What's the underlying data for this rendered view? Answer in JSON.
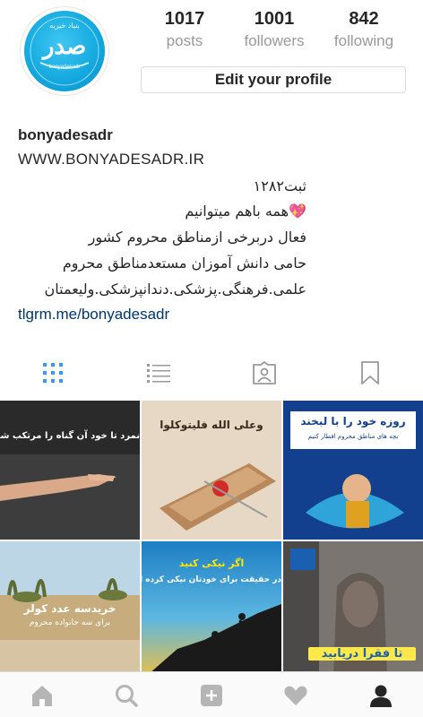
{
  "profile": {
    "avatar_title": "صدر",
    "avatar_top": "بنیاد خیریه",
    "avatar_bottom": "bonyadesadr",
    "stats": [
      {
        "count": "1017",
        "label": "posts"
      },
      {
        "count": "1001",
        "label": "followers"
      },
      {
        "count": "842",
        "label": "following"
      }
    ],
    "edit_label": "Edit your profile"
  },
  "bio": {
    "username": "bonyadesadr",
    "website": "WWW.BONYADESADR.IR",
    "lines": [
      "ثبت۱۲۸۲",
      "همه باهم میتوانیم",
      "فعال دربرخی ازمناطق محروم کشور",
      "حامی دانش آموزان مستعدمناطق محروم",
      "علمی.فرهنگی.پزشکی.دندانپزشکی.ولیعمتان"
    ],
    "heart_icon": "💖",
    "link": "tlgrm.me/bonyadesadr"
  },
  "tabs": [
    {
      "name": "grid-view",
      "icon": "grid-icon",
      "active": true
    },
    {
      "name": "list-view",
      "icon": "list-icon",
      "active": false
    },
    {
      "name": "tagged",
      "icon": "tagged-icon",
      "active": false
    },
    {
      "name": "saved",
      "icon": "bookmark-icon",
      "active": false
    }
  ],
  "posts": [
    {
      "caption": "نمرد تا خود آن گناه را مرتکب شود",
      "caption2": ""
    },
    {
      "caption": "وعلى الله فليتوكلوا",
      "caption2": ""
    },
    {
      "caption": "روزه خود را با لبخند",
      "caption2": "بچه های مناطق محروم افطار کنیم"
    },
    {
      "caption": "خریدسه عدد کولر",
      "caption2": "برای سه خانواده محروم"
    },
    {
      "caption": "اگر نیکی کنید",
      "caption2": "در حقیقت برای خودتان نیکی کرده اید"
    },
    {
      "caption": "تا فقرا دریابید",
      "caption2": ""
    }
  ],
  "colors": {
    "accent_blue": "#3897f0",
    "link": "#003569",
    "text": "#262626",
    "muted": "#999999"
  },
  "bottom_nav": [
    {
      "icon": "home-icon"
    },
    {
      "icon": "search-icon"
    },
    {
      "icon": "add-post-icon"
    },
    {
      "icon": "heart-icon"
    },
    {
      "icon": "profile-icon"
    }
  ]
}
